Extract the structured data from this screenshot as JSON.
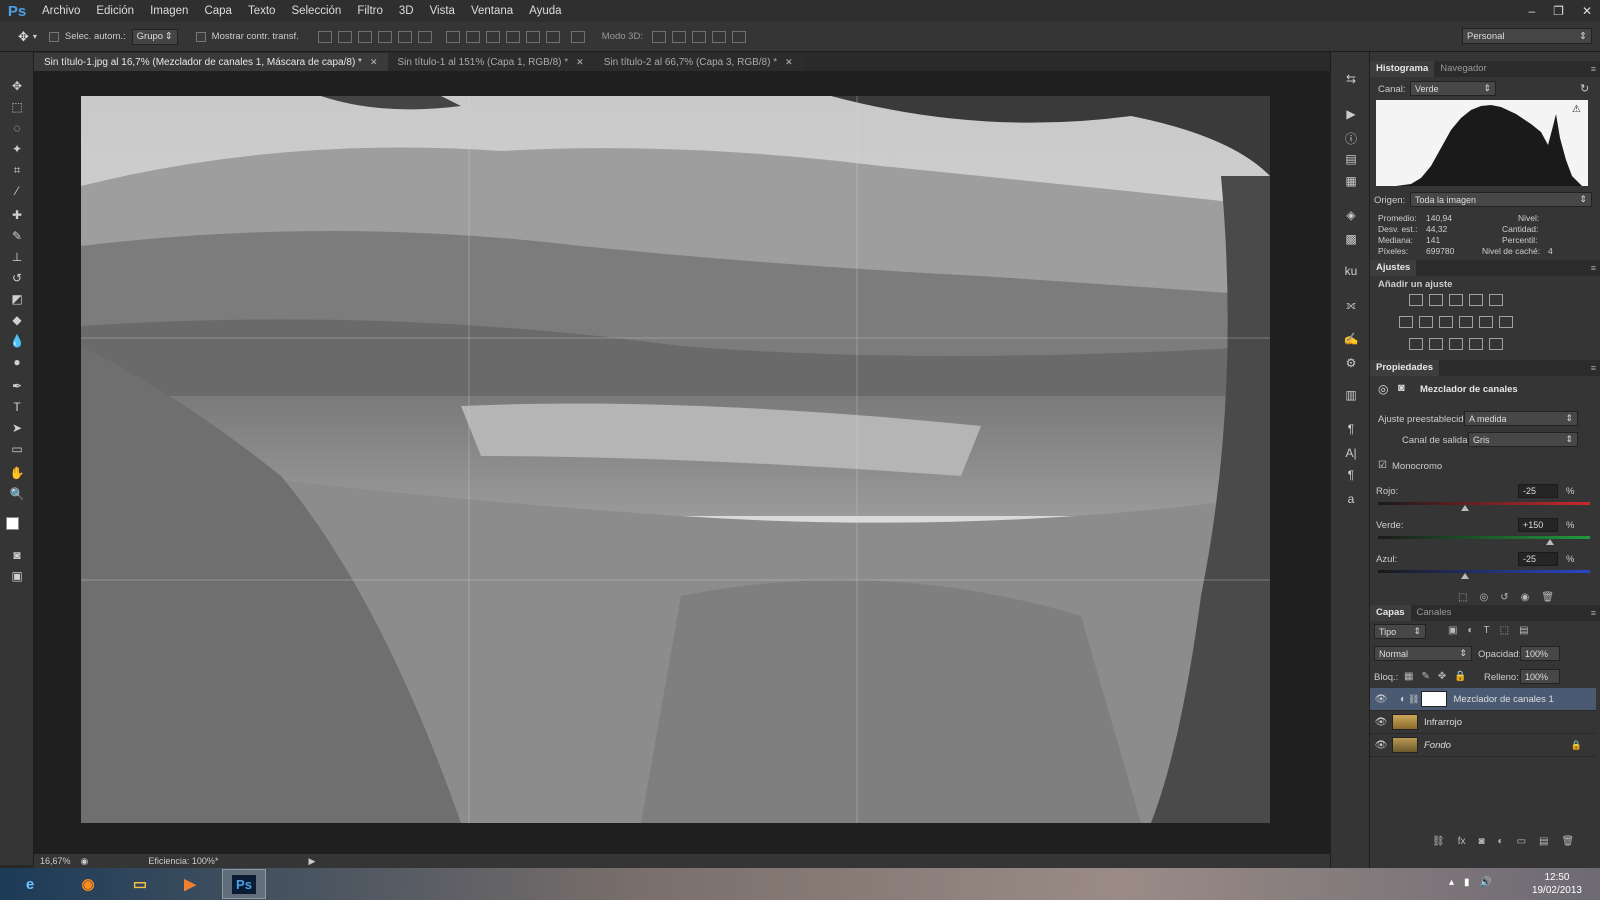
{
  "app": {
    "logo": "Ps"
  },
  "menu": [
    "Archivo",
    "Edición",
    "Imagen",
    "Capa",
    "Texto",
    "Selección",
    "Filtro",
    "3D",
    "Vista",
    "Ventana",
    "Ayuda"
  ],
  "window_controls": {
    "minimize": "–",
    "restore": "❐",
    "close": "✕"
  },
  "options_bar": {
    "auto_select_label": "Selec. autom.:",
    "auto_select_value": "Grupo",
    "show_transform_label": "Mostrar contr. transf.",
    "mode3d_label": "Modo 3D:",
    "workspace": "Personal"
  },
  "tabs": [
    {
      "label": "Sin título-1.jpg al 16,7% (Mezclador de canales 1, Máscara de capa/8) *",
      "active": true
    },
    {
      "label": "Sin título-1 al 151% (Capa 1, RGB/8) *",
      "active": false
    },
    {
      "label": "Sin título-2 al 66,7% (Capa 3, RGB/8) *",
      "active": false
    }
  ],
  "tab_close": "✕",
  "status": {
    "zoom": "16,67%",
    "efficiency": "Eficiencia: 100%*"
  },
  "histogram": {
    "tabs": [
      "Histograma",
      "Navegador"
    ],
    "channel_label": "Canal:",
    "channel_value": "Verde",
    "source_label": "Origen:",
    "source_value": "Toda la imagen",
    "stats": {
      "mean_label": "Promedio:",
      "mean": "140,94",
      "std_label": "Desv. est.:",
      "std": "44,32",
      "median_label": "Mediana:",
      "median": "141",
      "pixels_label": "Píxeles:",
      "pixels": "699780",
      "level_label": "Nivel:",
      "count_label": "Cantidad:",
      "percentile_label": "Percentil:",
      "cache_label": "Nivel de caché:",
      "cache": "4"
    }
  },
  "adjustments": {
    "tab": "Ajustes",
    "add_label": "Añadir un ajuste"
  },
  "properties": {
    "tab": "Propiedades",
    "title": "Mezclador de canales",
    "preset_label": "Ajuste preestablecido:",
    "preset_value": "A medida",
    "output_label": "Canal de salida:",
    "output_value": "Gris",
    "mono_label": "Monocromo",
    "mono_checked": true,
    "red_label": "Rojo:",
    "red_value": "-25",
    "green_label": "Verde:",
    "green_value": "+150",
    "blue_label": "Azul:",
    "blue_value": "-25",
    "pct": "%"
  },
  "layers": {
    "tabs": [
      "Capas",
      "Canales"
    ],
    "kind_filter": "Tipo",
    "blend_mode": "Normal",
    "opacity_label": "Opacidad:",
    "opacity": "100%",
    "lock_label": "Bloq.:",
    "fill_label": "Relleno:",
    "fill": "100%",
    "items": [
      {
        "name": "Mezclador de canales 1",
        "selected": true
      },
      {
        "name": "Infrarrojo",
        "selected": false
      },
      {
        "name": "Fondo",
        "selected": false
      }
    ]
  },
  "taskbar": {
    "time": "12:50",
    "date": "19/02/2013",
    "ps_label": "Ps"
  },
  "colors": {
    "accent": "#4b5a73",
    "ps_blue": "#4da0e8",
    "red_slider": "#c8282d",
    "green_slider": "#1e9a3c",
    "blue_slider": "#2a46c8"
  }
}
